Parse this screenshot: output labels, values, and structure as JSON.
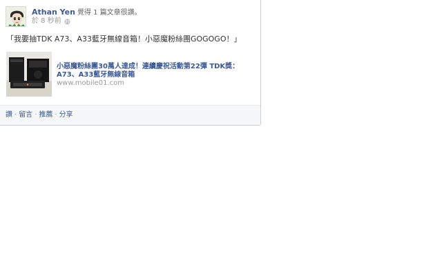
{
  "story": {
    "author": "Athan Yen",
    "verb": "覺得 1 篇文章很讚。",
    "timestamp": "於 8 秒前",
    "audience_icon": "globe-icon",
    "message": "「我要抽TDK A73、A33藍牙無線音箱！小惡魔粉絲團GOGOGO！」",
    "link": {
      "title": "小惡魔粉絲團30萬人達成！連續慶祝活動第22彈 TDK獎：A73、A33藍牙無線音箱",
      "domain": "www.mobile01.com"
    },
    "actions": [
      {
        "label": "讚"
      },
      {
        "label": "留言"
      },
      {
        "label": "推薦"
      },
      {
        "label": "分享"
      }
    ],
    "action_separator": "·"
  },
  "colors": {
    "link": "#3b5998",
    "meta_text": "#999999",
    "action_bar_bg": "#f6f7f9",
    "border": "#c4cde0"
  }
}
